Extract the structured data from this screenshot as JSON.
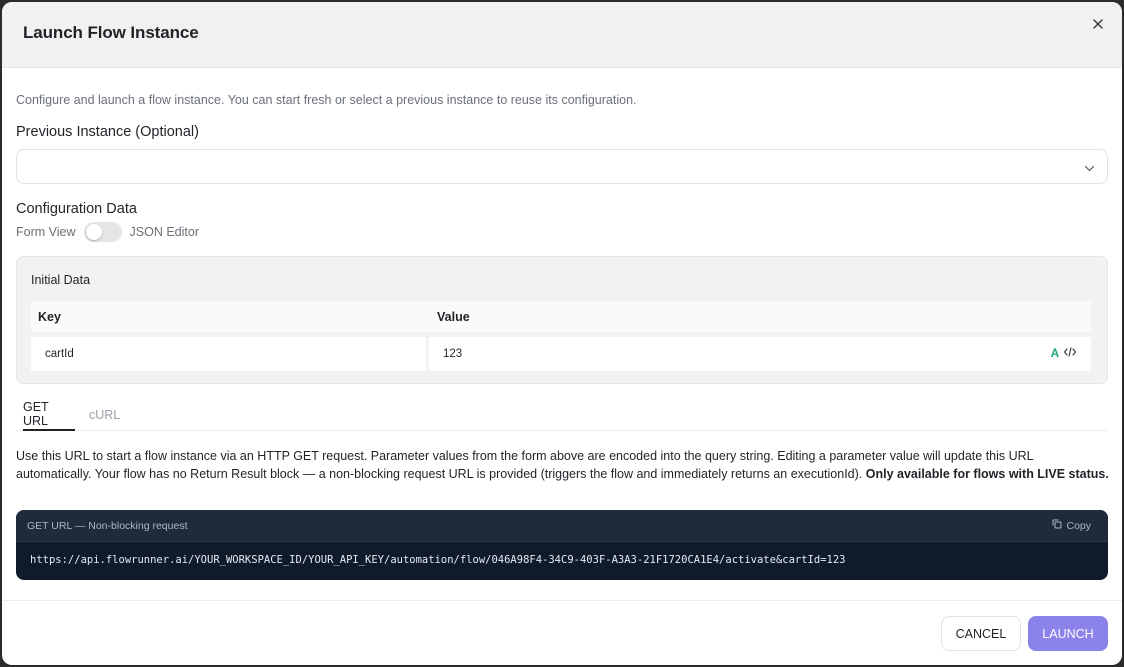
{
  "dialog": {
    "title": "Launch Flow Instance",
    "description": "Configure and launch a flow instance. You can start fresh or select a previous instance to reuse its configuration."
  },
  "previous_instance": {
    "label": "Previous Instance (Optional)",
    "selected_value": ""
  },
  "configuration": {
    "label": "Configuration Data",
    "form_view_label": "Form View",
    "json_editor_label": "JSON Editor",
    "json_editor_enabled": false
  },
  "initial_data": {
    "title": "Initial Data",
    "columns": [
      "Key",
      "Value"
    ],
    "rows": [
      {
        "key": "cartId",
        "value": "123",
        "type_icon": "A"
      }
    ]
  },
  "tabs": [
    {
      "label": "GET URL",
      "active": true
    },
    {
      "label": "cURL",
      "active": false
    }
  ],
  "url_section": {
    "description_normal": "Use this URL to start a flow instance via an HTTP GET request. Parameter values from the form above are encoded into the query string. Editing a parameter value will update this URL automatically. Your flow has no Return Result block — a non-blocking request URL is provided (triggers the flow and immediately returns an executionId). ",
    "description_bold": "Only available for flows with LIVE status.",
    "code_label": "GET URL — Non-blocking request",
    "copy_label": "Copy",
    "url": "https://api.flowrunner.ai/YOUR_WORKSPACE_ID/YOUR_API_KEY/automation/flow/046A98F4-34C9-403F-A3A3-21F1720CA1E4/activate&cartId=123"
  },
  "footer": {
    "cancel_label": "CANCEL",
    "launch_label": "LAUNCH"
  },
  "icons": {
    "close": "close-icon",
    "chevron": "chevron-down-icon",
    "text_type": "text-type-icon",
    "code": "code-icon",
    "copy": "copy-icon"
  },
  "colors": {
    "accent": "#8b83ea",
    "code_bg": "#0f1a2b",
    "text_type_icon": "#1aa57a"
  }
}
